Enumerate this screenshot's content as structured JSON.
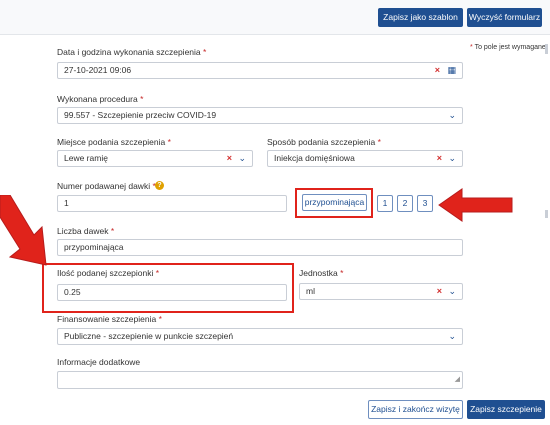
{
  "toolbar": {
    "save_template_label": "Zapisz jako szablon",
    "clear_form_label": "Wyczyść formularz"
  },
  "required_note": "To pole jest wymagane",
  "required_star": "*",
  "fields": {
    "datetime": {
      "label": "Data i godzina wykonania szczepienia",
      "value": "27-10-2021 09:06"
    },
    "procedure": {
      "label": "Wykonana procedura",
      "value": "99.557 - Szczepienie przeciw COVID-19"
    },
    "site": {
      "label": "Miejsce podania szczepienia",
      "value": "Lewe ramię"
    },
    "method": {
      "label": "Sposób podania szczepienia",
      "value": "Iniekcja domięśniowa"
    },
    "dose_number": {
      "label": "Numer podawanej dawki",
      "value": "1"
    },
    "dose_count": {
      "label": "Liczba dawek",
      "value": "przypominająca"
    },
    "amount": {
      "label": "Ilość podanej szczepionki",
      "value": "0.25"
    },
    "unit": {
      "label": "Jednostka",
      "value": "ml"
    },
    "funding": {
      "label": "Finansowanie szczepienia",
      "value": "Publiczne - szczepienie w punkcie szczepień"
    },
    "additional_info": {
      "label": "Informacje dodatkowe",
      "value": ""
    }
  },
  "dose_buttons": [
    "przypominająca",
    "1",
    "2",
    "3"
  ],
  "footer": {
    "save_close_label": "Zapisz i zakończ wizytę",
    "save_label": "Zapisz szczepienie"
  },
  "icons": {
    "clear": "×",
    "chevron": "⌄",
    "calendar": "▦",
    "help": "?"
  },
  "colors": {
    "primary": "#1f4f91",
    "required": "#c62828",
    "annotation_red": "#e0231b",
    "help_badge": "#e0a100"
  }
}
